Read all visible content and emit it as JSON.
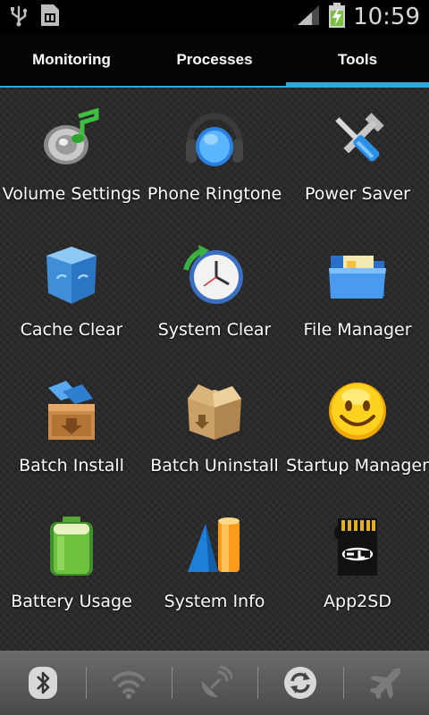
{
  "status_bar": {
    "time": "10:59",
    "icons": [
      "usb-icon",
      "sim-card-icon",
      "signal-icon",
      "battery-charging-icon"
    ]
  },
  "tabs": [
    {
      "label": "Monitoring",
      "active": false
    },
    {
      "label": "Processes",
      "active": false
    },
    {
      "label": "Tools",
      "active": true
    }
  ],
  "tools": [
    {
      "label": "Volume Settings",
      "icon": "speaker-music-icon"
    },
    {
      "label": "Phone Ringtone",
      "icon": "headphones-icon"
    },
    {
      "label": "Power Saver",
      "icon": "wrench-screwdriver-icon"
    },
    {
      "label": "Cache Clear",
      "icon": "recycle-box-icon"
    },
    {
      "label": "System Clear",
      "icon": "clock-refresh-icon"
    },
    {
      "label": "File Manager",
      "icon": "folder-icon"
    },
    {
      "label": "Batch Install",
      "icon": "box-install-icon"
    },
    {
      "label": "Batch Uninstall",
      "icon": "open-box-icon"
    },
    {
      "label": "Startup Manager",
      "icon": "smiley-icon"
    },
    {
      "label": "Battery Usage",
      "icon": "battery-icon"
    },
    {
      "label": "System Info",
      "icon": "shapes-icon"
    },
    {
      "label": "App2SD",
      "icon": "sd-card-icon"
    }
  ],
  "toggles": [
    {
      "name": "bluetooth",
      "icon": "bluetooth-icon",
      "enabled": true
    },
    {
      "name": "wifi",
      "icon": "wifi-icon",
      "enabled": false
    },
    {
      "name": "gps",
      "icon": "satellite-icon",
      "enabled": false
    },
    {
      "name": "sync",
      "icon": "sync-icon",
      "enabled": true
    },
    {
      "name": "airplane",
      "icon": "airplane-icon",
      "enabled": false
    }
  ],
  "colors": {
    "accent": "#2ea8d8",
    "tab_bg": "#050505",
    "grid_bg": "#2a2a2a",
    "toggle_bar_bg": "#5a5a5a"
  }
}
